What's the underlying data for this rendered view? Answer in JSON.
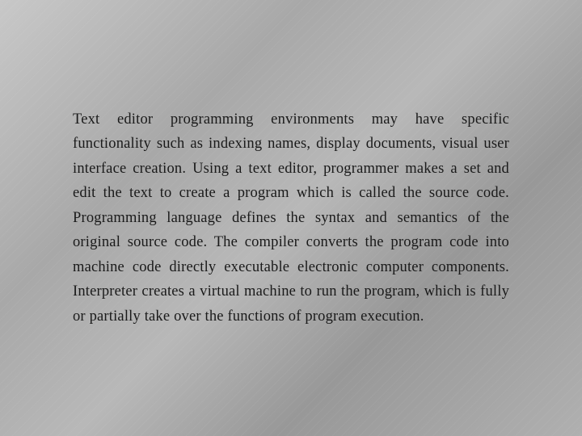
{
  "background": {
    "color_start": "#c8c8c8",
    "color_end": "#989898"
  },
  "content": {
    "paragraph": "Text editor programming environments may have specific functionality such as indexing names, display documents, visual user interface creation. Using a text editor, programmer makes a set and edit the text to create a program which is called the source code. Programming language defines the syntax and semantics of the original source code. The compiler converts the program code into machine code directly executable electronic computer components. Interpreter creates a virtual machine to run the program, which is fully or partially take over the functions of program execution."
  }
}
